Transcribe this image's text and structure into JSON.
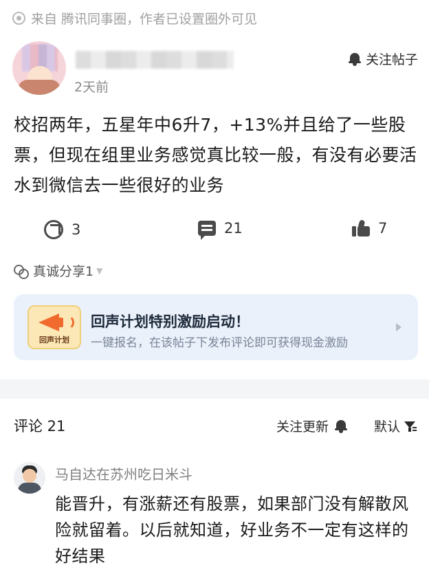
{
  "source": {
    "text": "来自 腾讯同事圈，作者已设置圈外可见"
  },
  "author": {
    "time": "2天前",
    "follow_label": "关注帖子"
  },
  "post": {
    "content": "校招两年，五星年中6升7，+13%并且给了一些股票，但现在组里业务感觉真比较一般，有没有必要活水到微信去一些很好的业务"
  },
  "actions": {
    "repost_count": "3",
    "comment_count": "21",
    "like_count": "7"
  },
  "tag": {
    "label": "真诚分享1"
  },
  "banner": {
    "logo_text": "回声计划",
    "title": "回声计划特别激励启动！",
    "subtitle": "一键报名，在该帖子下发布评论即可获得现金激励"
  },
  "comments_header": {
    "title": "评论 21",
    "follow_updates": "关注更新",
    "sort": "默认"
  },
  "comments": [
    {
      "name": "马自达在苏州吃日米斗",
      "text": "能晋升，有涨薪还有股票，如果部门没有解散风险就留着。以后就知道，好业务不一定有这样的好结果"
    }
  ]
}
